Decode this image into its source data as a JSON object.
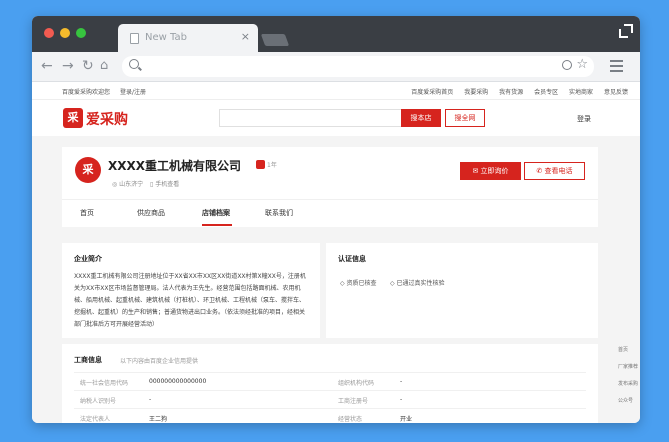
{
  "browser": {
    "tab_title": "New Tab",
    "tab_close": "×"
  },
  "topnav": {
    "left": [
      "百度爱采购欢迎您",
      "登录/注册"
    ],
    "right": [
      "百度爱采购首页",
      "我要采购",
      "我有货源",
      "会员专区",
      "实地商家",
      "意见反馈"
    ]
  },
  "header": {
    "logo_mark": "采",
    "logo_text": "爱采购",
    "search_button": "搜本店",
    "search_all_button": "搜全网",
    "login": "登录"
  },
  "company": {
    "logo_mark": "采",
    "name": "XXXX重工机械有限公司",
    "years": "1年",
    "location": "山东济宁",
    "mobile": "手机查看",
    "inquiry_button": "立即询价",
    "phone_button": "查看电话",
    "tabs": [
      "首页",
      "供应商品",
      "店铺档案",
      "联系我们"
    ]
  },
  "intro": {
    "title": "企业简介",
    "text": "XXXX重工机械有限公司注册地址位于XX省XX市XX区XX街道XX村第X幢XX号，注册机关为XX市XX区市场监督管理局。法人代表为王先生。经营范围包括路面机械、农用机械、船用机械、起重机械、建筑机械（打桩机）、环卫机械、工程机械（泵车、搅拌车、挖掘机、起重机）的生产和销售；普通货物进出口业务。（依法须经批准的项目，经相关部门批准后方可开展经营活动）"
  },
  "cert": {
    "title": "认证信息",
    "items": [
      "资质已核查",
      "已通过真实性核验"
    ]
  },
  "business": {
    "title": "工商信息",
    "subtitle": "以下内容由百度企业信用提供",
    "rows": [
      {
        "l1": "统一社会信用代码",
        "v1": "000000000000000",
        "l2": "组织机构代码",
        "v2": "-"
      },
      {
        "l1": "纳税人识别号",
        "v1": "-",
        "l2": "工商注册号",
        "v2": "-"
      },
      {
        "l1": "法定代表人",
        "v1": "王二狗",
        "l2": "经营状态",
        "v2": "开业"
      }
    ]
  },
  "side_float": [
    "首页",
    "厂家推荐",
    "发布采购",
    "公众号"
  ]
}
